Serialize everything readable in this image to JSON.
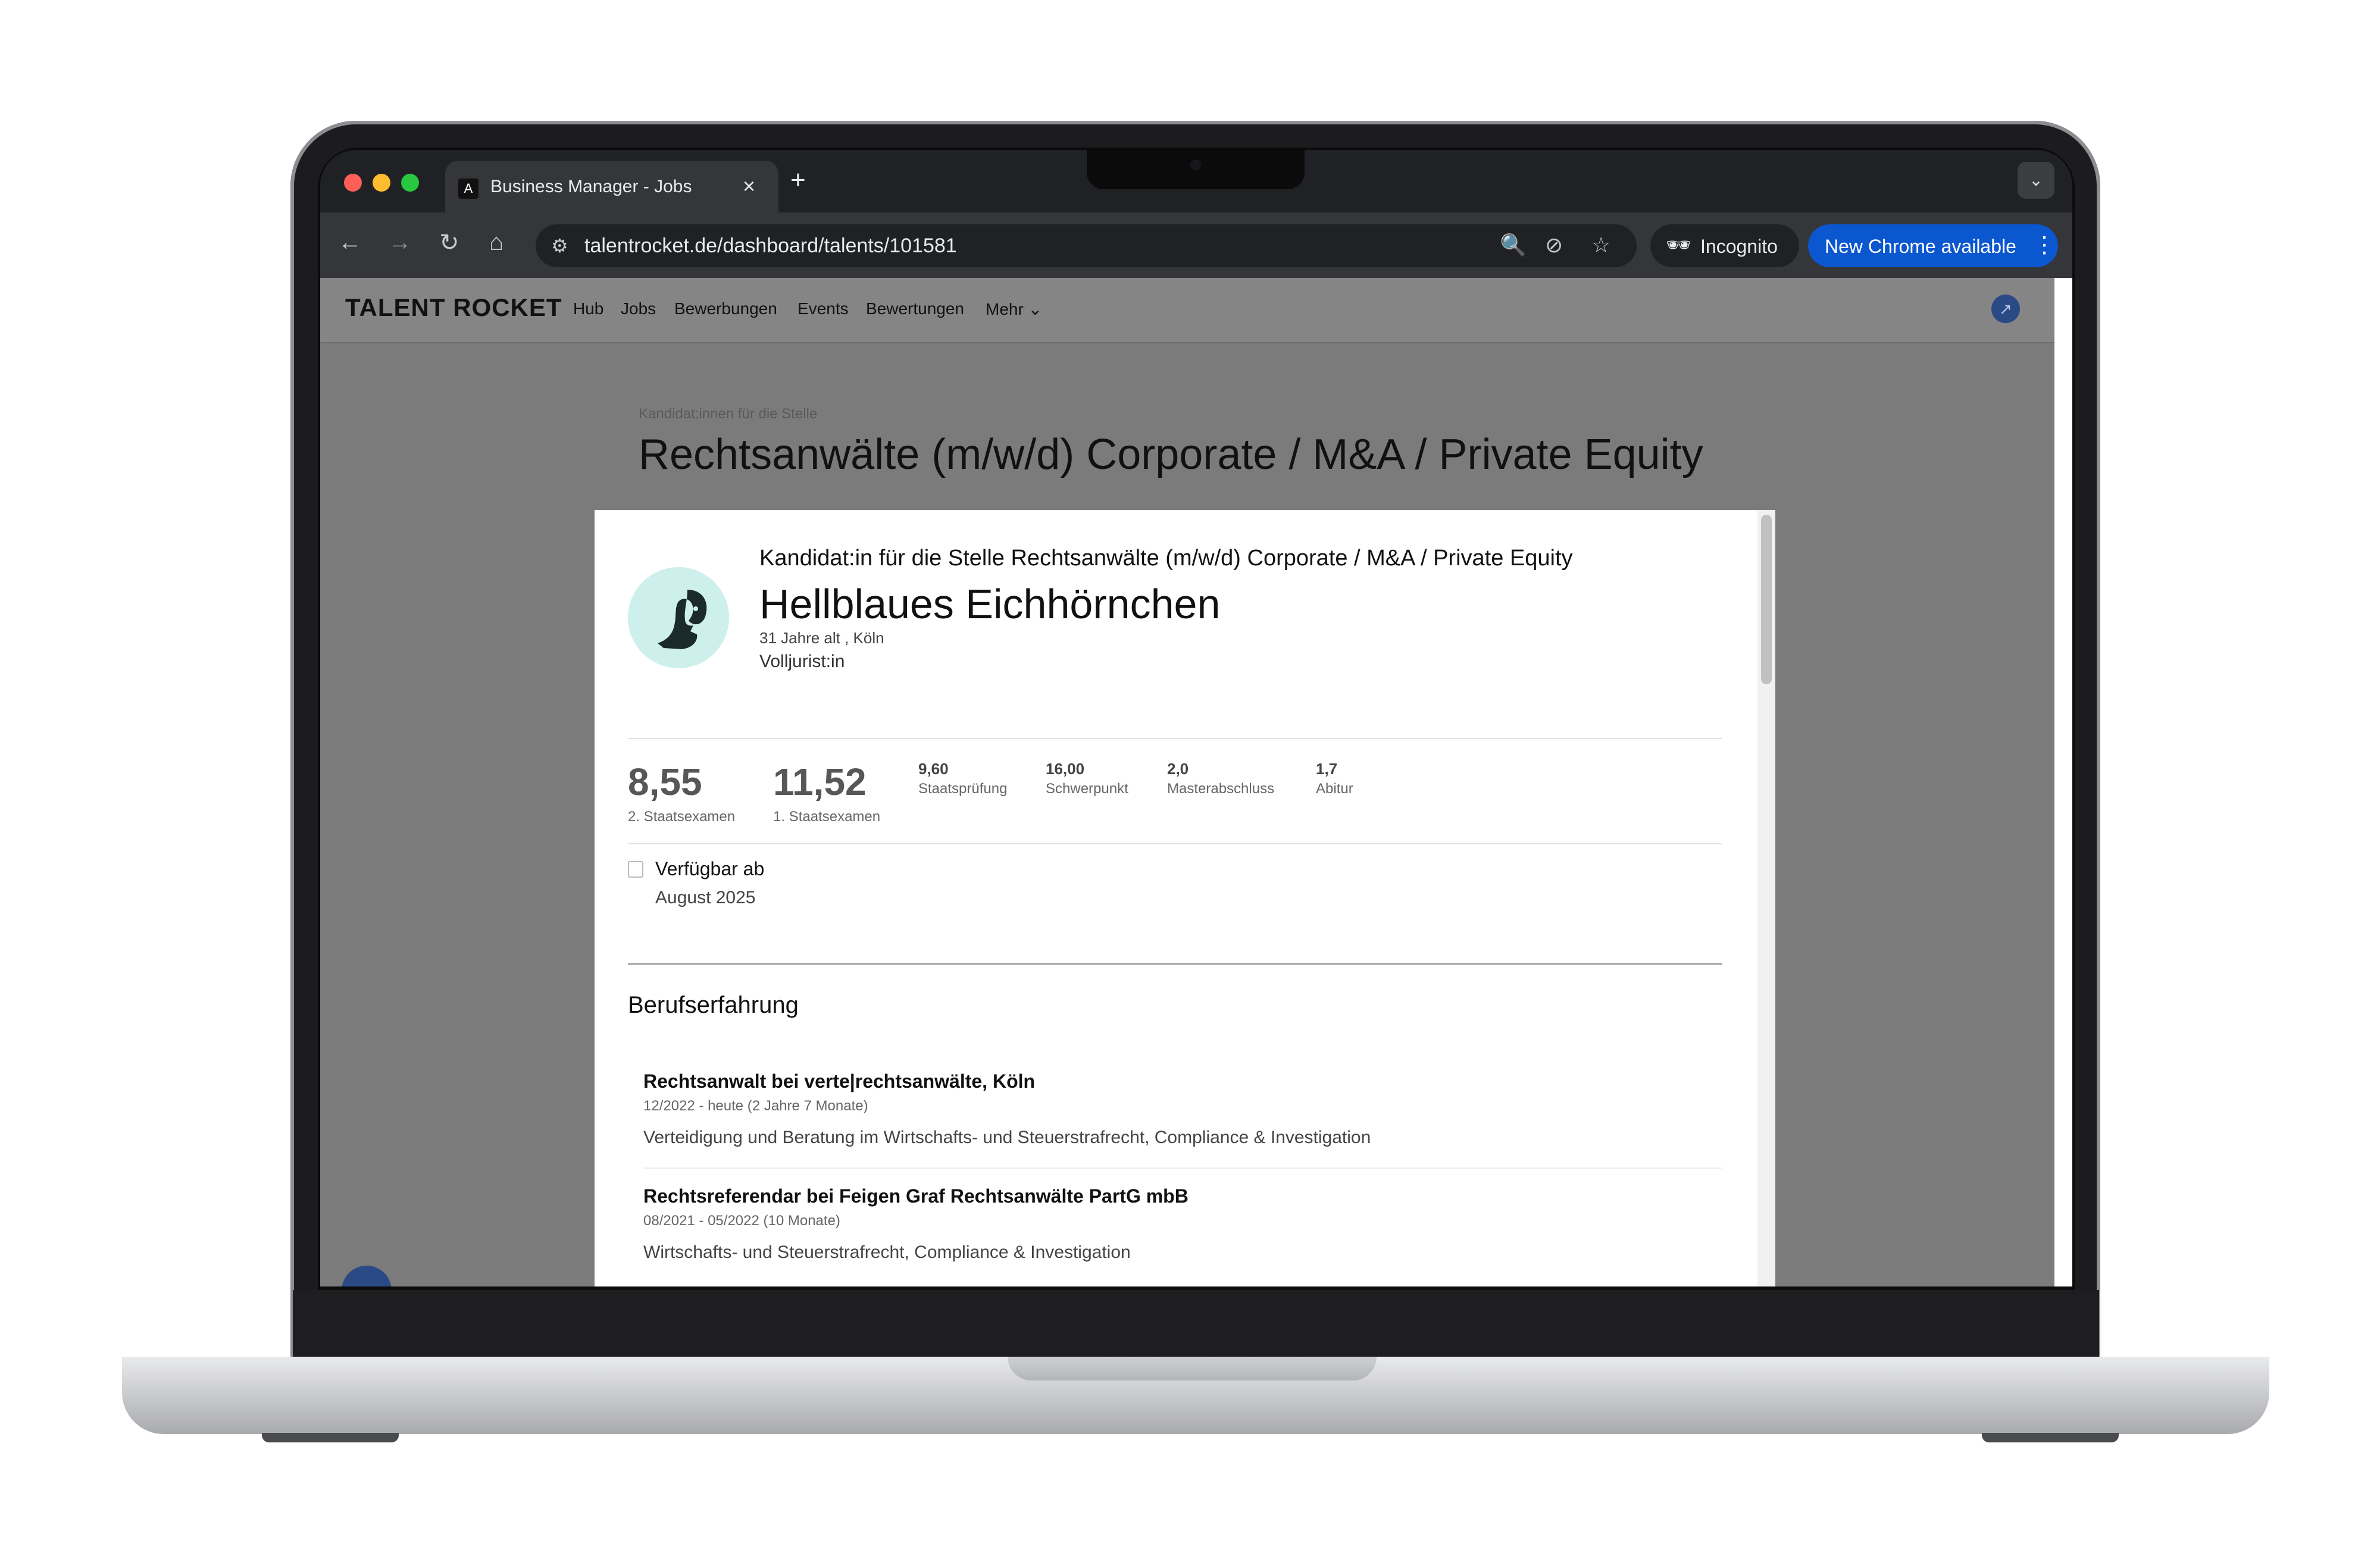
{
  "browser": {
    "tab_title": "Business Manager - Jobs",
    "tab_favicon": "A",
    "url": "talentrocket.de/dashboard/talents/101581",
    "incognito_label": "Incognito",
    "update_label": "New Chrome available",
    "icons": [
      "back-arrow-icon",
      "forward-arrow-icon",
      "reload-icon",
      "home-icon",
      "site-info-icon",
      "zoom-icon",
      "eye-off-icon",
      "star-icon",
      "incognito-icon",
      "kebab-menu-icon",
      "chevron-down-icon",
      "close-icon",
      "plus-icon"
    ]
  },
  "nav": {
    "brand": "TALENT ROCKET",
    "items": [
      "Hub",
      "Jobs",
      "Bewerbungen",
      "Events",
      "Bewertungen",
      "Mehr"
    ]
  },
  "page": {
    "pre_title": "Kandidat:innen für die Stelle",
    "title": "Rechtsanwälte (m/w/d) Corporate / M&A / Private Equity"
  },
  "candidate": {
    "subtitle": "Kandidat:in für die Stelle Rechtsanwälte (m/w/d) Corporate / M&A / Private Equity",
    "name": "Hellblaues Eichhörnchen",
    "meta": "31 Jahre alt , Köln",
    "role": "Volljurist:in",
    "avatar_color": "#cdf0ec",
    "grades_big": [
      {
        "value": "8,55",
        "label": "2. Staatsexamen"
      },
      {
        "value": "11,52",
        "label": "1. Staatsexamen"
      }
    ],
    "grades_small": [
      {
        "value": "9,60",
        "label": "Staatsprüfung"
      },
      {
        "value": "16,00",
        "label": "Schwerpunkt"
      },
      {
        "value": "2,0",
        "label": "Masterabschluss"
      },
      {
        "value": "1,7",
        "label": "Abitur"
      }
    ],
    "availability": {
      "label": "Verfügbar ab",
      "value": "August 2025"
    },
    "experience_title": "Berufserfahrung",
    "experience": [
      {
        "title": "Rechtsanwalt bei verte|rechtsanwälte, Köln",
        "date": "12/2022 - heute (2 Jahre 7 Monate)",
        "desc": "Verteidigung und Beratung im Wirtschafts- und Steuerstrafrecht, Compliance & Investigation"
      },
      {
        "title": "Rechtsreferendar bei Feigen Graf Rechtsanwälte PartG mbB",
        "date": "08/2021 - 05/2022 (10 Monate)",
        "desc": "Wirtschafts- und Steuerstrafrecht, Compliance & Investigation"
      }
    ]
  }
}
